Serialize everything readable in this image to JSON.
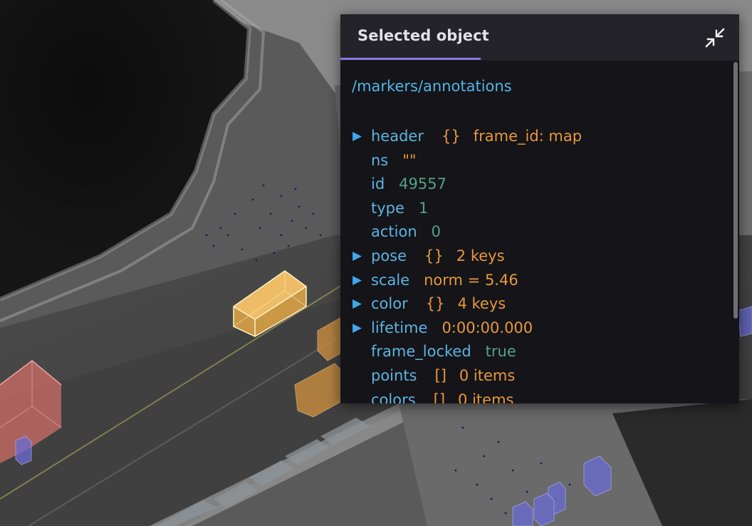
{
  "panel": {
    "tab_label": "Selected object",
    "topic": "/markers/annotations",
    "fields": [
      {
        "key": "header",
        "expandable": true,
        "brace": "{}",
        "value": "frame_id: map",
        "value_color": "orange"
      },
      {
        "key": "ns",
        "expandable": false,
        "brace": "",
        "value": "\"\"",
        "value_color": "orange"
      },
      {
        "key": "id",
        "expandable": false,
        "brace": "",
        "value": "49557",
        "value_color": "green"
      },
      {
        "key": "type",
        "expandable": false,
        "brace": "",
        "value": "1",
        "value_color": "green"
      },
      {
        "key": "action",
        "expandable": false,
        "brace": "",
        "value": "0",
        "value_color": "green"
      },
      {
        "key": "pose",
        "expandable": true,
        "brace": "{}",
        "value": "2 keys",
        "value_color": "orange"
      },
      {
        "key": "scale",
        "expandable": true,
        "brace": "",
        "value": "norm = 5.46",
        "value_color": "orange"
      },
      {
        "key": "color",
        "expandable": true,
        "brace": "{}",
        "value": "4 keys",
        "value_color": "orange"
      },
      {
        "key": "lifetime",
        "expandable": true,
        "brace": "",
        "value": "0:00:00.000",
        "value_color": "orange"
      },
      {
        "key": "frame_locked",
        "expandable": false,
        "brace": "",
        "value": "true",
        "value_color": "green"
      },
      {
        "key": "points",
        "expandable": false,
        "brace": "[]",
        "value": "0 items",
        "value_color": "orange"
      },
      {
        "key": "colors",
        "expandable": false,
        "brace": "[]",
        "value": "0 items",
        "value_color": "orange"
      }
    ]
  },
  "icons": {
    "collapse": "collapse-arrows-icon",
    "expand_row": "triangle-right-icon"
  },
  "colors": {
    "key": "#5db4e0",
    "value_orange": "#e8983a",
    "value_green": "#53a384",
    "tab_underline": "#8d76e8",
    "selected_box": "#f0b44a",
    "annotation_car": "#d9963f",
    "annotation_truck": "#d8706a",
    "annotation_pedestrian": "#6b6bd6"
  }
}
